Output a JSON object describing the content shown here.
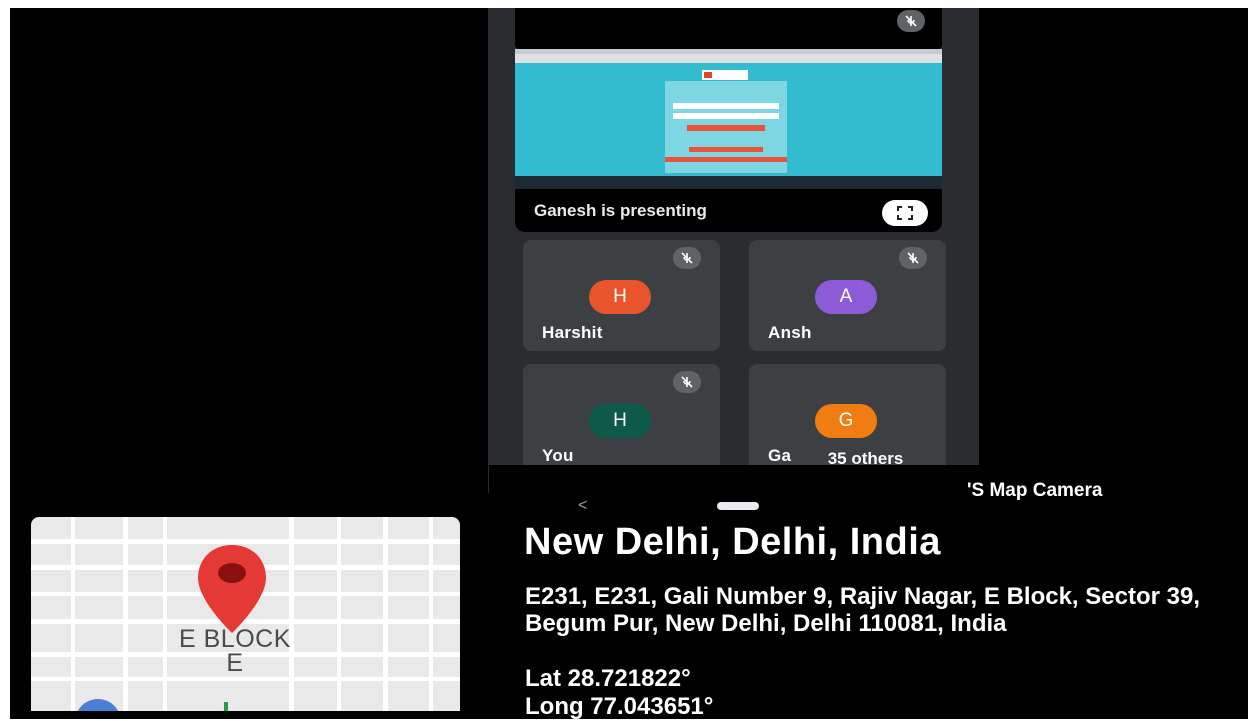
{
  "meet": {
    "presenting_label": "Ganesh is presenting",
    "participants": [
      {
        "name": "Harshit",
        "initial": "H",
        "color": "#e8552c"
      },
      {
        "name": "Ansh",
        "initial": "A",
        "color": "#8e5bd8"
      },
      {
        "name": "You",
        "initial": "H",
        "color": "#0e5a48"
      },
      {
        "name": "Ganesh",
        "initial": "G",
        "color": "#f07c12"
      }
    ],
    "others_label": "35 others",
    "ganesh_partial": "Ga"
  },
  "nav": {
    "back_glyph": "<"
  },
  "map": {
    "label_line1": "E BLOCK",
    "label_line2": "E"
  },
  "gps": {
    "brand": "'S Map Camera",
    "city": "New Delhi, Delhi, India",
    "address": "E231, E231, Gali Number 9, Rajiv Nagar, E Block, Sector 39, Begum Pur, New Delhi, Delhi 110081, India",
    "lat": "Lat 28.721822°",
    "long": "Long 77.043651°"
  },
  "colors": {
    "meet_bg": "#2b2c2f",
    "tile_bg": "#3c4043",
    "pin": "#e53935"
  }
}
